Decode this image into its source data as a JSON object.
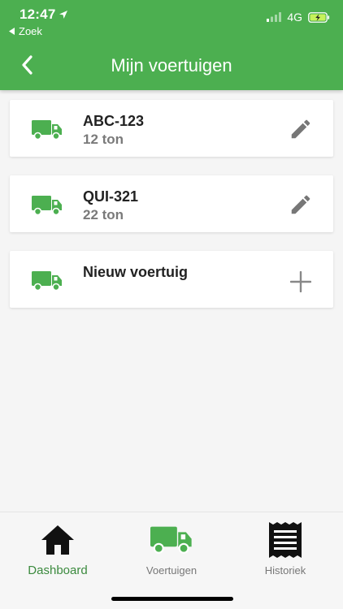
{
  "status_bar": {
    "time": "12:47",
    "back_label": "Zoek",
    "network": "4G"
  },
  "nav": {
    "title": "Mijn voertuigen"
  },
  "vehicles": [
    {
      "plate": "ABC-123",
      "weight": "12 ton",
      "action": "edit"
    },
    {
      "plate": "QUI-321",
      "weight": "22 ton",
      "action": "edit"
    }
  ],
  "new_vehicle": {
    "label": "Nieuw voertuig",
    "action": "add"
  },
  "tabs": [
    {
      "label": "Dashboard",
      "icon": "home-icon",
      "active": true
    },
    {
      "label": "Voertuigen",
      "icon": "truck-icon",
      "active": false
    },
    {
      "label": "Historiek",
      "icon": "receipt-icon",
      "active": false
    }
  ],
  "colors": {
    "brand_green": "#4caf50",
    "active_tab_label": "#3b8a3e",
    "secondary_text": "#7a7a7a"
  }
}
